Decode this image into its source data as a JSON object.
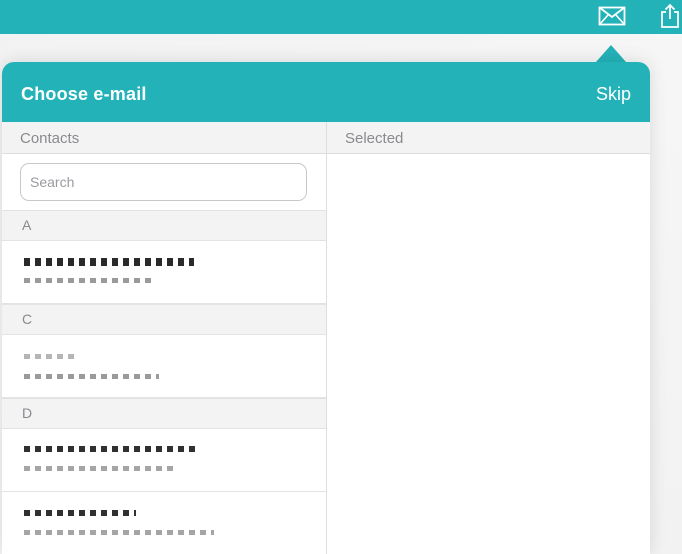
{
  "topbar": {
    "mail_icon": "envelope-icon",
    "share_icon": "share-icon",
    "color": "#23b2b8"
  },
  "popover": {
    "title": "Choose e-mail",
    "skip_label": "Skip",
    "header_color": "#23b2b8"
  },
  "columns": {
    "contacts_label": "Contacts",
    "selected_label": "Selected"
  },
  "search": {
    "placeholder": "Search",
    "value": ""
  },
  "sections": [
    {
      "letter": "A"
    },
    {
      "letter": "C"
    },
    {
      "letter": "D"
    }
  ],
  "contacts_note": "contact names and emails are pixelated/redacted in the screenshot"
}
